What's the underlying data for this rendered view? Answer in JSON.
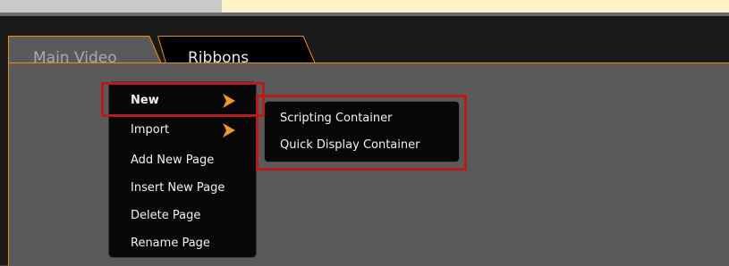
{
  "tabs": [
    {
      "label": "Main Video",
      "active": true
    },
    {
      "label": "Ribbons",
      "active": false
    }
  ],
  "context_menu": {
    "items": [
      {
        "label": "New",
        "has_submenu": true,
        "highlighted": true
      },
      {
        "label": "Import",
        "has_submenu": true
      },
      {
        "label": "Add New Page"
      },
      {
        "label": "Insert New Page"
      },
      {
        "label": "Delete Page"
      },
      {
        "label": "Rename Page"
      }
    ]
  },
  "submenu": {
    "parent": "New",
    "items": [
      {
        "label": "Scripting Container"
      },
      {
        "label": "Quick Display Container"
      }
    ]
  },
  "colors": {
    "accent": "#f08a1c",
    "highlight_box": "#b71b1b",
    "panel": "#5a5a5a",
    "window": "#1a1a1a",
    "menu": "#080808"
  },
  "icons": [
    "submenu-arrow-icon"
  ]
}
